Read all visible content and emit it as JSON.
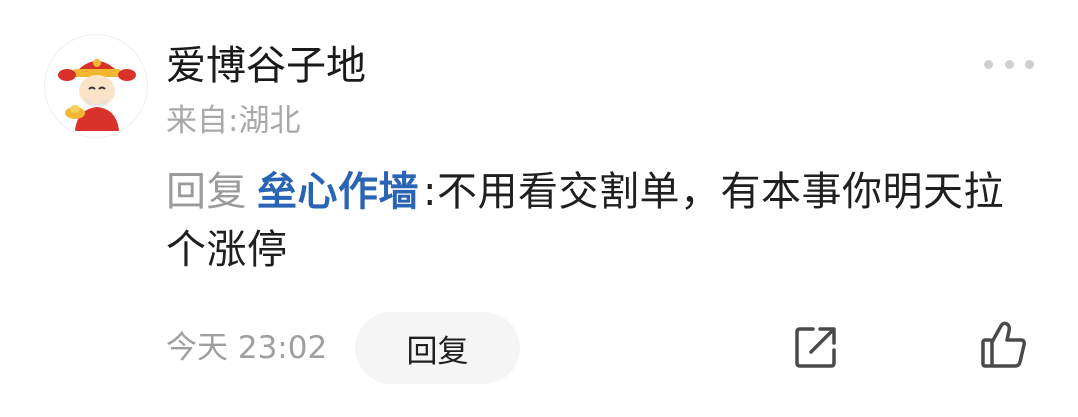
{
  "comment": {
    "username": "爱博谷子地",
    "location": "来自:湖北",
    "reply_prefix": "回复",
    "reply_target": "垒心作墙",
    "separator": ":",
    "text": "不用看交割单，有本事你明天拉个涨停",
    "time": "今天 23:02",
    "reply_button_label": "回复"
  },
  "icons": {
    "avatar": "caishen-avatar-icon",
    "more": "more-dots-icon",
    "share": "share-external-icon",
    "like": "thumbs-up-icon"
  },
  "colors": {
    "username": "#1a1a1a",
    "muted": "#a8a8a8",
    "mention": "#2a64b4",
    "reply_button_bg": "#f5f5f5"
  }
}
